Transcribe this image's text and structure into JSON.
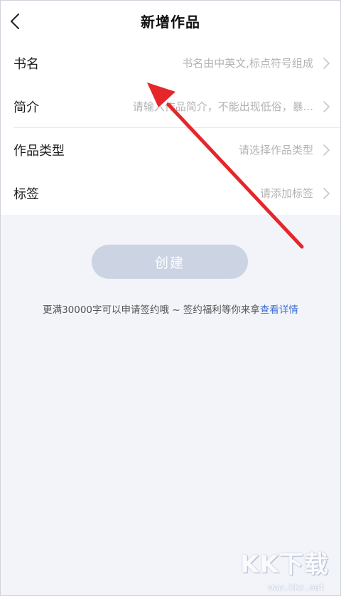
{
  "header": {
    "title": "新增作品",
    "back_icon": "chevron-left-icon"
  },
  "form": {
    "rows": [
      {
        "label": "书名",
        "placeholder": "书名由中英文,标点符号组成"
      },
      {
        "label": "简介",
        "placeholder": "请输入作品简介，不能出现低俗，暴..."
      },
      {
        "label": "作品类型",
        "placeholder": "请选择作品类型"
      },
      {
        "label": "标签",
        "placeholder": "请添加标签"
      }
    ],
    "chevron_icon": "chevron-right-icon"
  },
  "create_button": {
    "label": "创建"
  },
  "tip": {
    "text": "更满30000字可以申请签约哦 ~ 签约福利等你来拿",
    "link": "查看详情"
  },
  "colors": {
    "background": "#f2f4f9",
    "button_disabled": "#ccd3e3",
    "link": "#3f6fd6",
    "annotation_arrow": "#e5262a"
  },
  "watermark": {
    "logo": "KK下载",
    "url": "www.kkx.net"
  }
}
